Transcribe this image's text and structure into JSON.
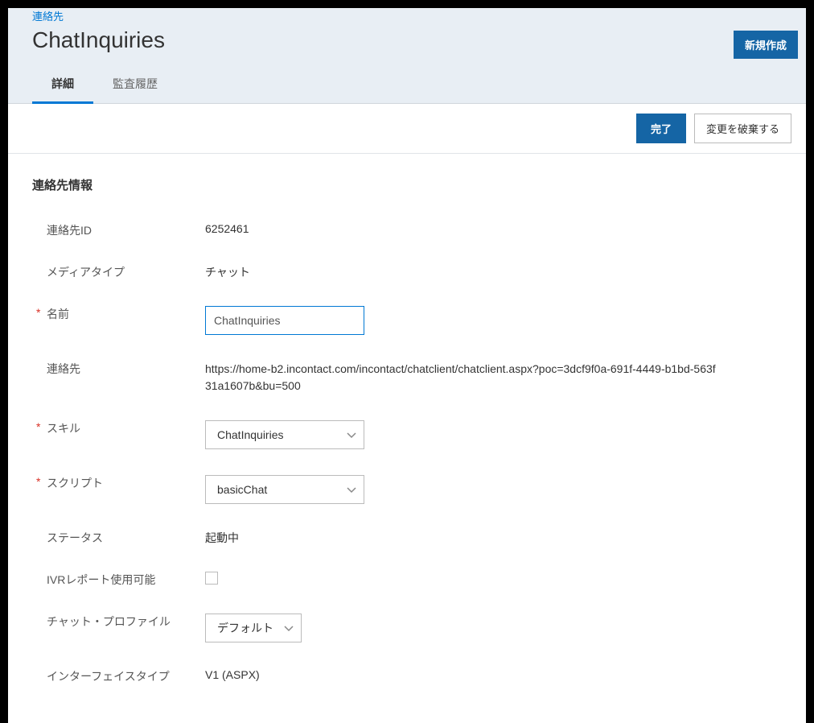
{
  "breadcrumb": "連絡先",
  "page_title": "ChatInquiries",
  "create_new_label": "新規作成",
  "tabs": {
    "details": "詳細",
    "audit": "監査履歴"
  },
  "actions": {
    "done": "完了",
    "discard": "変更を破棄する"
  },
  "section_title": "連絡先情報",
  "fields": {
    "contact_id": {
      "label": "連絡先ID",
      "value": "6252461"
    },
    "media_type": {
      "label": "メディアタイプ",
      "value": "チャット"
    },
    "name": {
      "label": "名前",
      "value": "ChatInquiries"
    },
    "contact": {
      "label": "連絡先",
      "value": "https://home-b2.incontact.com/incontact/chatclient/chatclient.aspx?poc=3dcf9f0a-691f-4449-b1bd-563f31a1607b&bu=500"
    },
    "skill": {
      "label": "スキル",
      "value": "ChatInquiries"
    },
    "script": {
      "label": "スクリプト",
      "value": "basicChat"
    },
    "status": {
      "label": "ステータス",
      "value": "起動中"
    },
    "ivr_report": {
      "label": "IVRレポート使用可能"
    },
    "chat_profile": {
      "label": "チャット・プロファイル",
      "value": "デフォルト"
    },
    "interface_type": {
      "label": "インターフェイスタイプ",
      "value": "V1 (ASPX)"
    }
  }
}
